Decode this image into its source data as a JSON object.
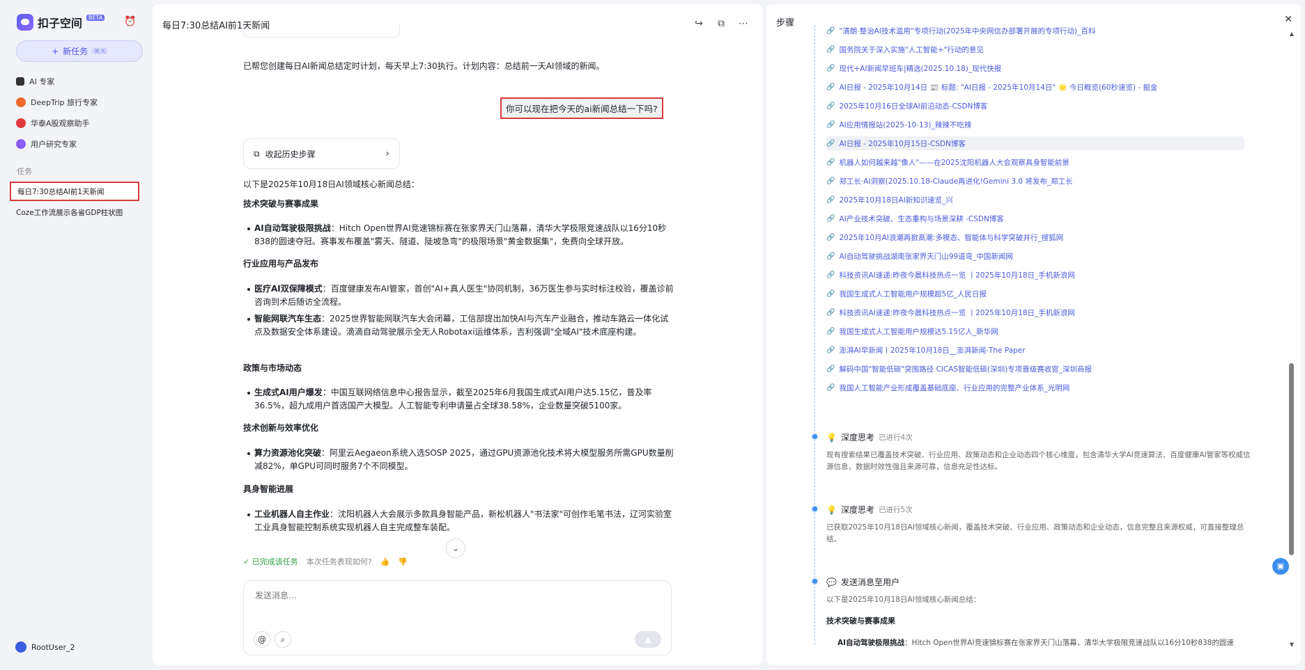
{
  "sidebar": {
    "brand": "扣子空间",
    "beta": "BETA",
    "new_task": "新任务",
    "new_task_kbd": "⌘ K",
    "experts": [
      {
        "label": "AI 专家",
        "color": "#333333"
      },
      {
        "label": "DeepTrip 旅行专家",
        "color": "#f06a2e"
      },
      {
        "label": "华泰A股观察助手",
        "color": "#e0393e"
      },
      {
        "label": "用户研究专家",
        "color": "#8a5ef0"
      }
    ],
    "section_label": "任务",
    "tasks": [
      {
        "label": "每日7:30总结AI前1天新闻"
      },
      {
        "label": "Coze工作流展示各省GDP柱状图"
      }
    ],
    "user": "RootUser_2"
  },
  "main": {
    "title": "每日7:30总结AI前1天新闻",
    "confirm_text": "已帮您创建每日AI新闻总结定时计划，每天早上7:30执行。计划内容：总结前一天AI领域的新闻。",
    "user_message": "你可以现在把今天的ai新闻总结一下吗?",
    "collapse_label": "收起历史步骤",
    "intro": "以下是2025年10月18日AI领域核心新闻总结：",
    "sections": [
      {
        "heading": "技术突破与赛事成果",
        "items": [
          {
            "bold": "AI自动驾驶极限挑战",
            "text": "：Hitch Open世界AI竞速锦标赛在张家界天门山落幕，清华大学极限竞速战队以16分10秒838的圆速夺冠。赛事发布覆盖\"雾天、隧道、陡坡急弯\"的极限场景\"黄金数据集\"，免费向全球开放。"
          }
        ]
      },
      {
        "heading": "行业应用与产品发布",
        "items": [
          {
            "bold": "医疗AI双保障模式",
            "text": "：百度健康发布AI管家，首创\"AI+真人医生\"协同机制，36万医生参与实时标注校验，覆盖诊前咨询到术后随访全流程。"
          },
          {
            "bold": "智能网联汽车生态",
            "text": "：2025世界智能网联汽车大会闭幕，工信部提出加快AI与汽车产业融合，推动车路云一体化试点及数据安全体系建设。滴滴自动驾驶展示全无人Robotaxi运维体系，吉利强调\"全域AI\"技术底座构建。"
          }
        ]
      },
      {
        "heading": "政策与市场动态",
        "items": [
          {
            "bold": "生成式AI用户爆发",
            "text": "：中国互联网络信息中心报告显示，截至2025年6月我国生成式AI用户达5.15亿，普及率36.5%，超九成用户首选国产大模型。人工智能专利申请量占全球38.58%，企业数量突破5100家。"
          }
        ]
      },
      {
        "heading": "技术创新与效率优化",
        "items": [
          {
            "bold": "算力资源池化突破",
            "text": "：阿里云Aegaeon系统入选SOSP 2025，通过GPU资源池化技术将大模型服务所需GPU数量削减82%，单GPU可同时服务7个不同模型。"
          }
        ]
      },
      {
        "heading": "具身智能进展",
        "items": [
          {
            "bold": "工业机器人自主作业",
            "text": "：沈阳机器人大会展示多款具身智能产品，新松机器人\"书法家\"可创作毛笔书法，辽河实验室工业具身智能控制系统实现机器人自主完成整车装配。"
          }
        ]
      }
    ],
    "done_label": "已完成该任务",
    "feedback_label": "本次任务表现如何?",
    "composer_placeholder": "发送消息..."
  },
  "panel": {
    "title": "步骤",
    "links": [
      "\"清朗·整治AI技术滥用\"专项行动(2025年中央网信办部署开展的专项行动)_百科",
      "国务院关于深入实施\"人工智能+\"行动的意见",
      "现代+AI新闻早班车|精选(2025.10.18)_现代快报",
      "AI日报 - 2025年10月14日 📰 标题: \"AI日报 - 2025年10月14日\" 🌟 今日概览(60秒速览) - 掘金",
      "2025年10月16日全球AI前沿动态-CSDN博客",
      "AI应用情报站(2025-10-13)_辣辣不吃辣",
      "AI日报 - 2025年10月15日-CSDN博客",
      "机器人如何越来越\"像人\"——在2025沈阳机器人大会观察具身智能前景",
      "郑工长·AI洞察(2025.10.18-Claude再进化!Gemini 3.0 将发布_郑工长",
      "2025年10月18日AI新知识速览_兴",
      "AI产业技术突破、生态重构与场景深耕 -CSDN博客",
      "2025年10月AI浪潮再掀高潮:多模态、智能体与科学突破并行_搜狐网",
      "AI自动驾驶挑战湖南张家界天门山99道弯_中国新闻网",
      "科技资讯AI速递:昨夜今晨科技热点一览 丨2025年10月18日_手机新浪网",
      "我国生成式人工智能用户规模超5亿_人民日报",
      "科技资讯AI速递:昨夜今晨科技热点一览 丨2025年10月18日_手机新浪网",
      "我国生成式人工智能用户规模达5.15亿人_新华网",
      "澎湃AI早新闻丨2025年10月18日__澎湃新闻-The Paper",
      "解码中国\"智能低碳\"突围路径 CICAS智能低碳(深圳)专项晋级赛收官_深圳商报",
      "我国人工智能产业形成覆盖基础底座、行业应用的完整产业体系_光明网"
    ],
    "highlighted_link": 6,
    "steps": [
      {
        "title": "深度思考",
        "meta": "已进行4次",
        "text": "现有搜索结果已覆盖技术突破、行业应用、政策动态和企业动态四个核心维度，包含清华大学AI竞速算法、百度健康AI管家等权威信源信息，数据时效性强且来源可靠，信息充足性达标。"
      },
      {
        "title": "深度思考",
        "meta": "已进行5次",
        "text": "已获取2025年10月18日AI领域核心新闻，覆盖技术突破、行业应用、政策动态和企业动态，信息完整且来源权威，可直接整理总结。"
      }
    ],
    "send_step": {
      "title": "发送消息至用户",
      "intro": "以下是2025年10月18日AI领域核心新闻总结：",
      "heading": "技术突破与赛事成果",
      "bullet_bold": "AI自动驾驶极限挑战",
      "bullet_text": "：Hitch Open世界AI竞速锦标赛在张家界天门山落幕，清华大学极限竞速战队以16分10秒838的圆速"
    }
  }
}
